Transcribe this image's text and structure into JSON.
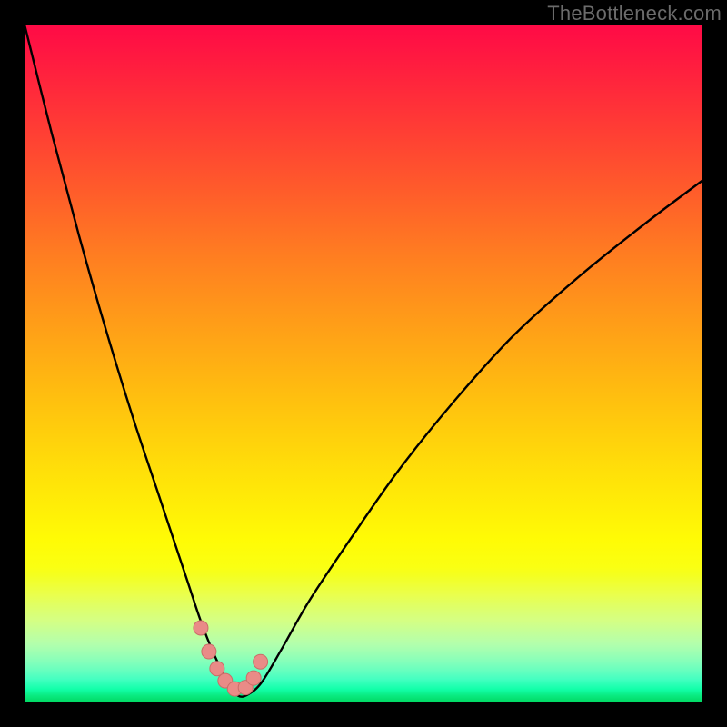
{
  "watermark": "TheBottleneck.com",
  "colors": {
    "frame": "#000000",
    "curve_stroke": "#000000",
    "marker_fill": "#e98b87",
    "marker_stroke": "#c96e68"
  },
  "chart_data": {
    "type": "line",
    "title": "",
    "xlabel": "",
    "ylabel": "",
    "xlim": [
      0,
      100
    ],
    "ylim": [
      0,
      100
    ],
    "grid": false,
    "legend": false,
    "series": [
      {
        "name": "bottleneck-curve",
        "x": [
          0,
          4,
          8,
          12,
          16,
          20,
          24,
          26,
          28,
          30,
          31.5,
          33,
          35,
          38,
          42,
          48,
          55,
          63,
          72,
          82,
          92,
          100
        ],
        "y": [
          100,
          84,
          69,
          55,
          42,
          30,
          18,
          12,
          7,
          3,
          1,
          1.2,
          3,
          8,
          15,
          24,
          34,
          44,
          54,
          63,
          71,
          77
        ]
      }
    ],
    "markers": {
      "name": "highlight-dots",
      "x": [
        26.0,
        27.2,
        28.4,
        29.6,
        31.0,
        32.6,
        33.8,
        34.8
      ],
      "y": [
        11.0,
        7.5,
        5.0,
        3.2,
        2.0,
        2.2,
        3.6,
        6.0
      ]
    }
  }
}
